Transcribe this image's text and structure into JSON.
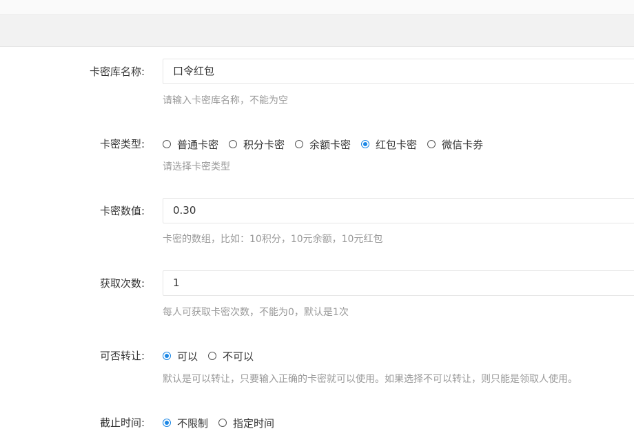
{
  "form": {
    "name": {
      "label": "卡密库名称:",
      "value": "口令红包",
      "help": "请输入卡密库名称，不能为空"
    },
    "type": {
      "label": "卡密类型:",
      "options": [
        "普通卡密",
        "积分卡密",
        "余额卡密",
        "红包卡密",
        "微信卡券"
      ],
      "selected": "红包卡密",
      "help": "请选择卡密类型"
    },
    "value": {
      "label": "卡密数值:",
      "value": "0.30",
      "help": "卡密的数组，比如：10积分，10元余额，10元红包"
    },
    "times": {
      "label": "获取次数:",
      "value": "1",
      "help": "每人可获取卡密次数，不能为0，默认是1次"
    },
    "transfer": {
      "label": "可否转让:",
      "options": [
        "可以",
        "不可以"
      ],
      "selected": "可以",
      "help": "默认是可以转让，只要输入正确的卡密就可以使用。如果选择不可以转让，则只能是领取人使用。"
    },
    "deadline": {
      "label": "截止时间:",
      "options": [
        "不限制",
        "指定时间"
      ],
      "selected": "不限制"
    }
  },
  "colors": {
    "accent": "#1e88e5",
    "help_text": "#999999",
    "border": "#e6e6e6"
  }
}
